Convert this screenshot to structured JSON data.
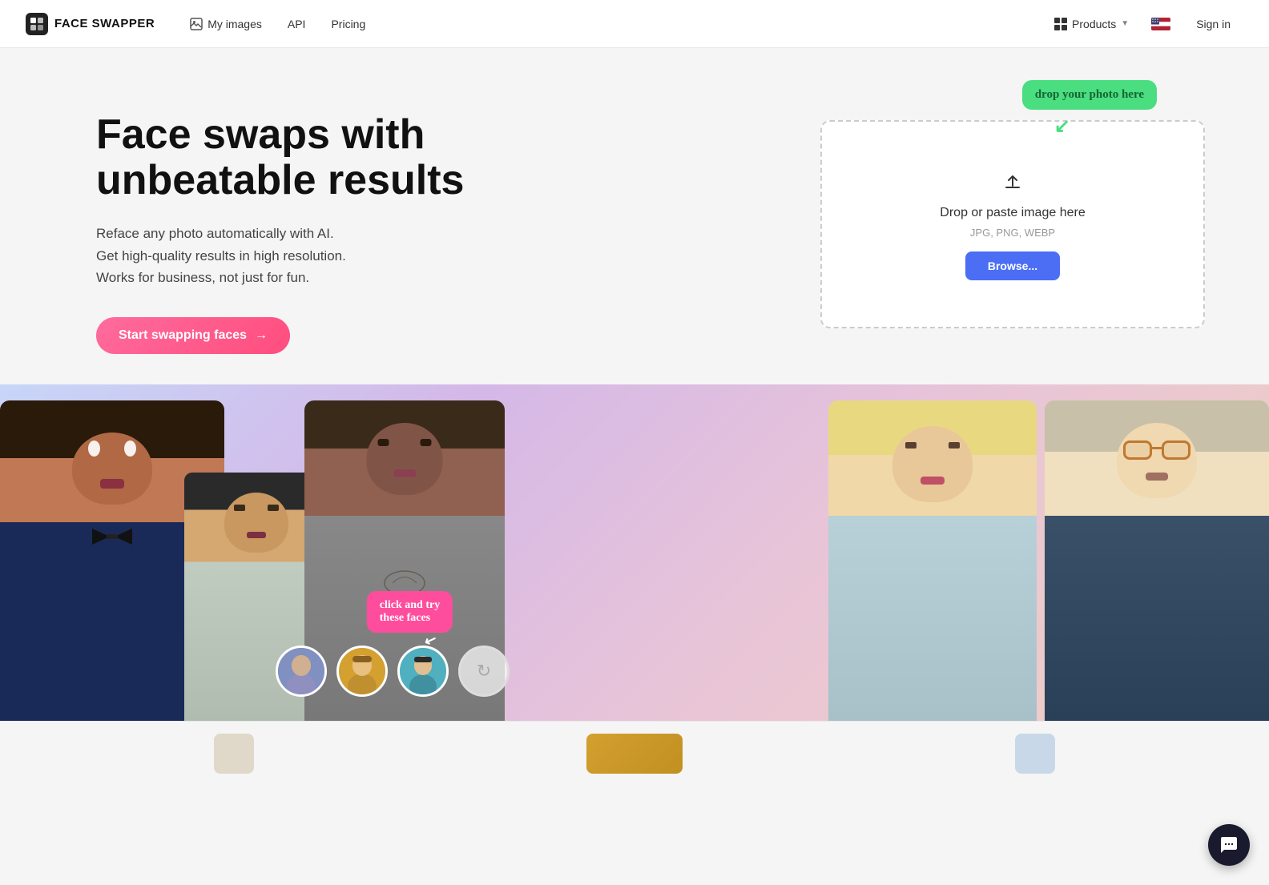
{
  "navbar": {
    "logo_text": "FACE SWAPPER",
    "logo_icon": "FS",
    "nav_links": [
      {
        "id": "my-images",
        "label": "My images",
        "icon": "image"
      },
      {
        "id": "api",
        "label": "API",
        "icon": null
      },
      {
        "id": "pricing",
        "label": "Pricing",
        "icon": null
      }
    ],
    "products_label": "Products",
    "signin_label": "Sign in"
  },
  "hero": {
    "title_line1": "Face swaps with",
    "title_line2": "unbeatable results",
    "subtitle_line1": "Reface any photo automatically with AI.",
    "subtitle_line2": "Get high-quality results in high resolution.",
    "subtitle_line3": "Works for business, not just for fun.",
    "cta_label": "Start swapping faces",
    "cta_arrow": "→"
  },
  "upload": {
    "tooltip_text": "drop your photo here",
    "drop_text": "Drop or paste image here",
    "formats_text": "JPG, PNG, WEBP",
    "browse_label": "Browse...",
    "upload_icon": "↑"
  },
  "faces": {
    "click_tooltip": "click and try\nthese faces",
    "persons": [
      {
        "id": "person-1",
        "style": "tuxedo"
      },
      {
        "id": "person-2",
        "style": "casual-kid"
      },
      {
        "id": "person-3",
        "style": "tattooed"
      },
      {
        "id": "person-4",
        "style": "blonde-woman"
      },
      {
        "id": "person-5",
        "style": "glasses-man"
      }
    ],
    "face_circles": [
      {
        "id": "face-1",
        "color": "#8090c0"
      },
      {
        "id": "face-2",
        "color": "#e0c060"
      },
      {
        "id": "face-3",
        "color": "#50c0d0"
      }
    ],
    "refresh_icon": "↻"
  },
  "chat": {
    "icon": "💬"
  }
}
